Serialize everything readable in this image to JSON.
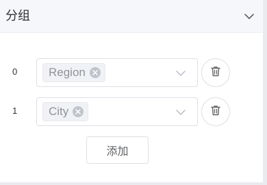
{
  "section": {
    "title": "分组",
    "toggle_icon": "chevron-down-icon"
  },
  "groups": [
    {
      "index": "0",
      "tag": "Region"
    },
    {
      "index": "1",
      "tag": "City"
    }
  ],
  "add_label": "添加",
  "colors": {
    "header_bg": "#f5f7fa",
    "border": "#dcdfe6",
    "tag_bg": "#f0f2f5",
    "tag_text": "#909399",
    "icon": "#606266"
  }
}
